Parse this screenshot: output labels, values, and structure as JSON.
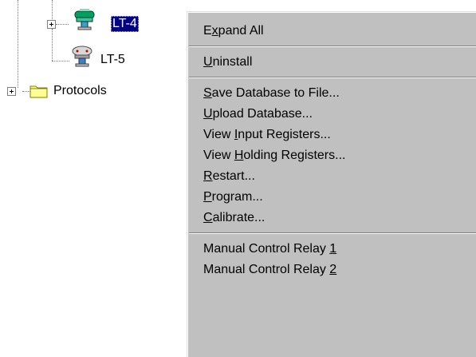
{
  "tree": {
    "nodes": [
      {
        "label": "LT-4",
        "selected": true,
        "icon": "transmitter-green-icon"
      },
      {
        "label": "LT-5",
        "selected": false,
        "icon": "transmitter-gray-icon"
      },
      {
        "label": "Protocols",
        "selected": false,
        "icon": "folder-icon"
      }
    ]
  },
  "context_menu": {
    "groups": [
      [
        {
          "label": "Expand All",
          "access_key_index": 1
        }
      ],
      [
        {
          "label": "Uninstall",
          "access_key_index": 0
        }
      ],
      [
        {
          "label": "Save Database to File...",
          "access_key_index": 0
        },
        {
          "label": "Upload Database...",
          "access_key_index": 0
        },
        {
          "label": "View Input Registers...",
          "access_key_index": 5
        },
        {
          "label": "View Holding Registers...",
          "access_key_index": 5
        },
        {
          "label": "Restart...",
          "access_key_index": 0
        },
        {
          "label": "Program...",
          "access_key_index": 0
        },
        {
          "label": "Calibrate...",
          "access_key_index": 0
        }
      ],
      [
        {
          "label": "Manual Control Relay 1",
          "access_key_index": 21
        },
        {
          "label": "Manual Control Relay 2",
          "access_key_index": 21
        }
      ]
    ]
  },
  "colors": {
    "selection_bg": "#000080",
    "menu_bg": "#c0c0c0",
    "folder": "#ffff80"
  }
}
